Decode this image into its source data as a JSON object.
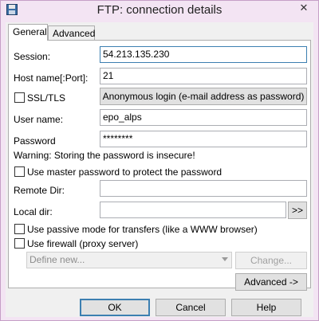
{
  "window": {
    "title": "FTP: connection details",
    "close_glyph": "✕",
    "app_icon": "floppy-disk-icon"
  },
  "tabs": [
    {
      "label": "General",
      "active": true
    },
    {
      "label": "Advanced",
      "active": false
    }
  ],
  "form": {
    "session_label": "Session:",
    "session_value": "54.213.135.230",
    "host_label": "Host name[:Port]:",
    "host_value": "21",
    "ssl_label": "SSL/TLS",
    "anonymous_button": "Anonymous login (e-mail address as password)",
    "username_label": "User name:",
    "username_value": "epo_alps",
    "password_label": "Password",
    "password_value": "********",
    "warning_text": "Warning: Storing the password is insecure!",
    "master_password_label": "Use master password to protect the password",
    "remote_dir_label": "Remote Dir:",
    "remote_dir_value": "",
    "local_dir_label": "Local dir:",
    "local_dir_value": "",
    "browse_button": ">>",
    "passive_mode_label": "Use passive mode for transfers (like a WWW browser)",
    "firewall_label": "Use firewall (proxy server)",
    "firewall_select": "Define new...",
    "change_button": "Change...",
    "advanced_button": "Advanced ->"
  },
  "footer": {
    "ok": "OK",
    "cancel": "Cancel",
    "help": "Help"
  }
}
